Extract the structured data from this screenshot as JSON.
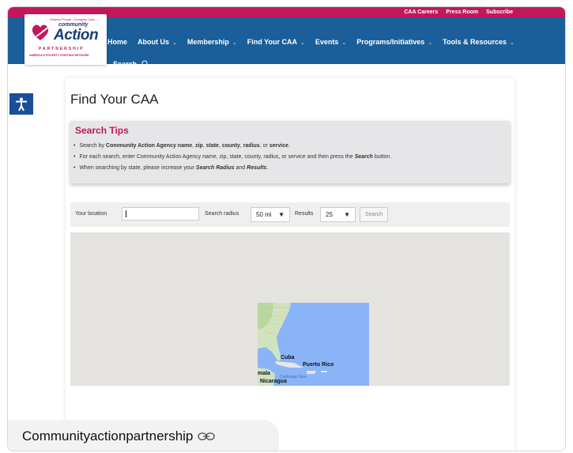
{
  "top_links": [
    "CAA Careers",
    "Press Room",
    "Subscribe"
  ],
  "logo": {
    "tagline": "Helping People. Changing Lives.",
    "community": "community",
    "action": "Action",
    "partnership": "PARTNERSHIP",
    "network": "AMERICA'S POVERTY FIGHTING NETWORK"
  },
  "nav": {
    "items": [
      {
        "label": "Home",
        "dropdown": false
      },
      {
        "label": "About Us",
        "dropdown": true
      },
      {
        "label": "Membership",
        "dropdown": true
      },
      {
        "label": "Find Your CAA",
        "dropdown": true
      },
      {
        "label": "Events",
        "dropdown": true
      },
      {
        "label": "Programs/Initiatives",
        "dropdown": true
      },
      {
        "label": "Tools & Resources",
        "dropdown": true
      }
    ],
    "search_label": "Search"
  },
  "page": {
    "title": "Find Your CAA"
  },
  "tips": {
    "heading": "Search Tips",
    "item1_pre": "Search by ",
    "item1_b1": "Community Action Agency name",
    "item1_c1": ", ",
    "item1_b2": "zip",
    "item1_c2": ", ",
    "item1_b3": "state",
    "item1_c3": ", ",
    "item1_b4": "county",
    "item1_c4": ", ",
    "item1_b5": "radius",
    "item1_c5": ", or ",
    "item1_b6": "service",
    "item1_end": ".",
    "item2_pre": "For each search, enter Community Action Agency name, zip, state, county, radius, or service and then press the ",
    "item2_b": "Search",
    "item2_end": " button.",
    "item3_pre": "When searching by state, please increase your ",
    "item3_b1": "Search Radius",
    "item3_mid": " and ",
    "item3_b2": "Results",
    "item3_end": "."
  },
  "search": {
    "location_label": "Your location",
    "location_value": "",
    "radius_label": "Search radius",
    "radius_value": "50 mi",
    "results_label": "Results",
    "results_value": "25",
    "button_label": "Search"
  },
  "map": {
    "labels": [
      "Cuba",
      "Puerto Rico",
      "mala",
      "Caribbean Sea",
      "Nicaragua"
    ]
  },
  "footer": {
    "site_name": "Communityactionpartnership"
  },
  "colors": {
    "topbar": "#c2185b",
    "nav": "#1a5f9a",
    "accent": "#c2185b",
    "a11y": "#1a4e99"
  }
}
